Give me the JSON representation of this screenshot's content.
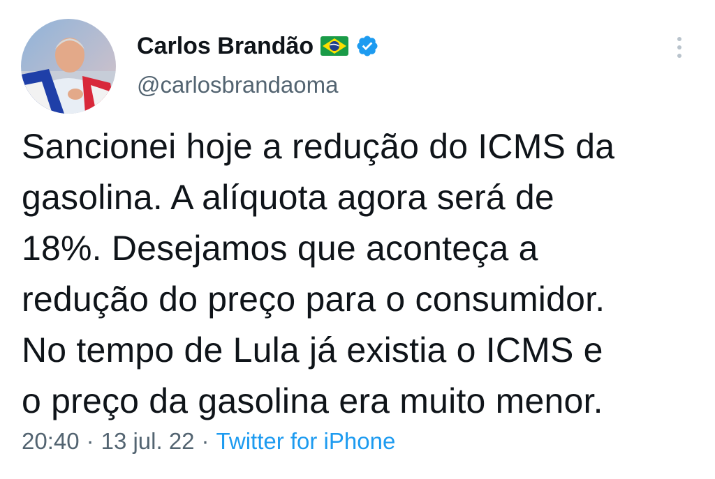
{
  "author": {
    "display_name": "Carlos Brandão",
    "handle": "@carlosbrandaoma",
    "flag_icon": "brazil-flag-icon",
    "verified_icon": "verified-badge-icon",
    "verified_color": "#1d9bf0"
  },
  "tweet": {
    "text": "Sancionei hoje a redução do ICMS da\ngasolina. A alíquota agora será de\n18%. Desejamos que aconteça a\nredução do preço para o consumidor.\nNo tempo de Lula já existia o ICMS e\no preço da gasolina era muito menor.",
    "time": "20:40",
    "date": "13 jul. 22",
    "separator": "·",
    "source": "Twitter for iPhone"
  },
  "menu": {
    "icon": "more-vertical-icon"
  },
  "colors": {
    "text": "#0f1419",
    "secondary": "#536471",
    "link": "#1d9bf0"
  }
}
